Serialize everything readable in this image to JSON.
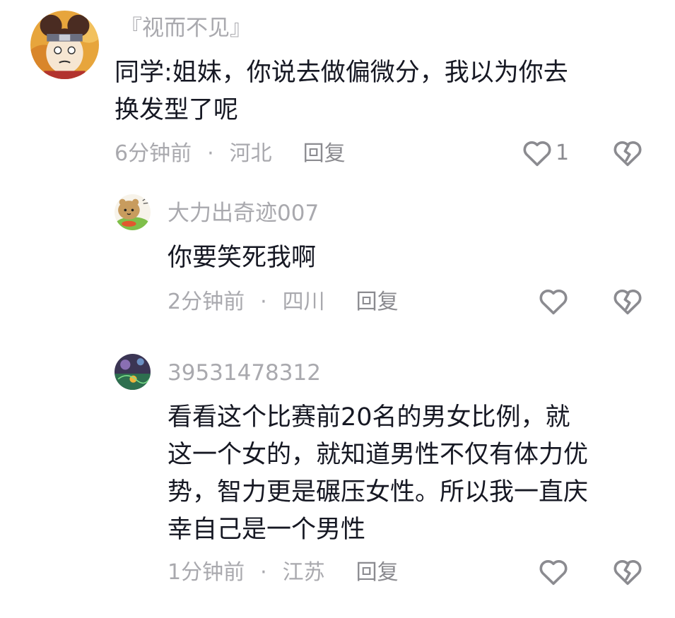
{
  "comments": [
    {
      "username": "『视而不见』",
      "text_lines": [
        "同学:姐妹，你说去做偏微分，我以为你去",
        "换发型了呢"
      ],
      "time": "6分钟前",
      "location": "河北",
      "reply_label": "回复",
      "likes": "1"
    },
    {
      "username": "大力出奇迹007",
      "text_lines": [
        "你要笑死我啊"
      ],
      "time": "2分钟前",
      "location": "四川",
      "reply_label": "回复",
      "likes": ""
    },
    {
      "username": "39531478312",
      "text_lines": [
        "看看这个比赛前20名的男女比例，就",
        "这一个女的，就知道男性不仅有体力优",
        "势，智力更是碾压女性。所以我一直庆",
        "幸自己是一个男性"
      ],
      "time": "1分钟前",
      "location": "江苏",
      "reply_label": "回复",
      "likes": ""
    }
  ],
  "separator": "·",
  "icons": {
    "like": "heart-outline-icon",
    "dislike": "broken-heart-icon"
  },
  "colors": {
    "text": "#161823",
    "muted": "#a9a9ae",
    "icon": "#8b8b90"
  }
}
